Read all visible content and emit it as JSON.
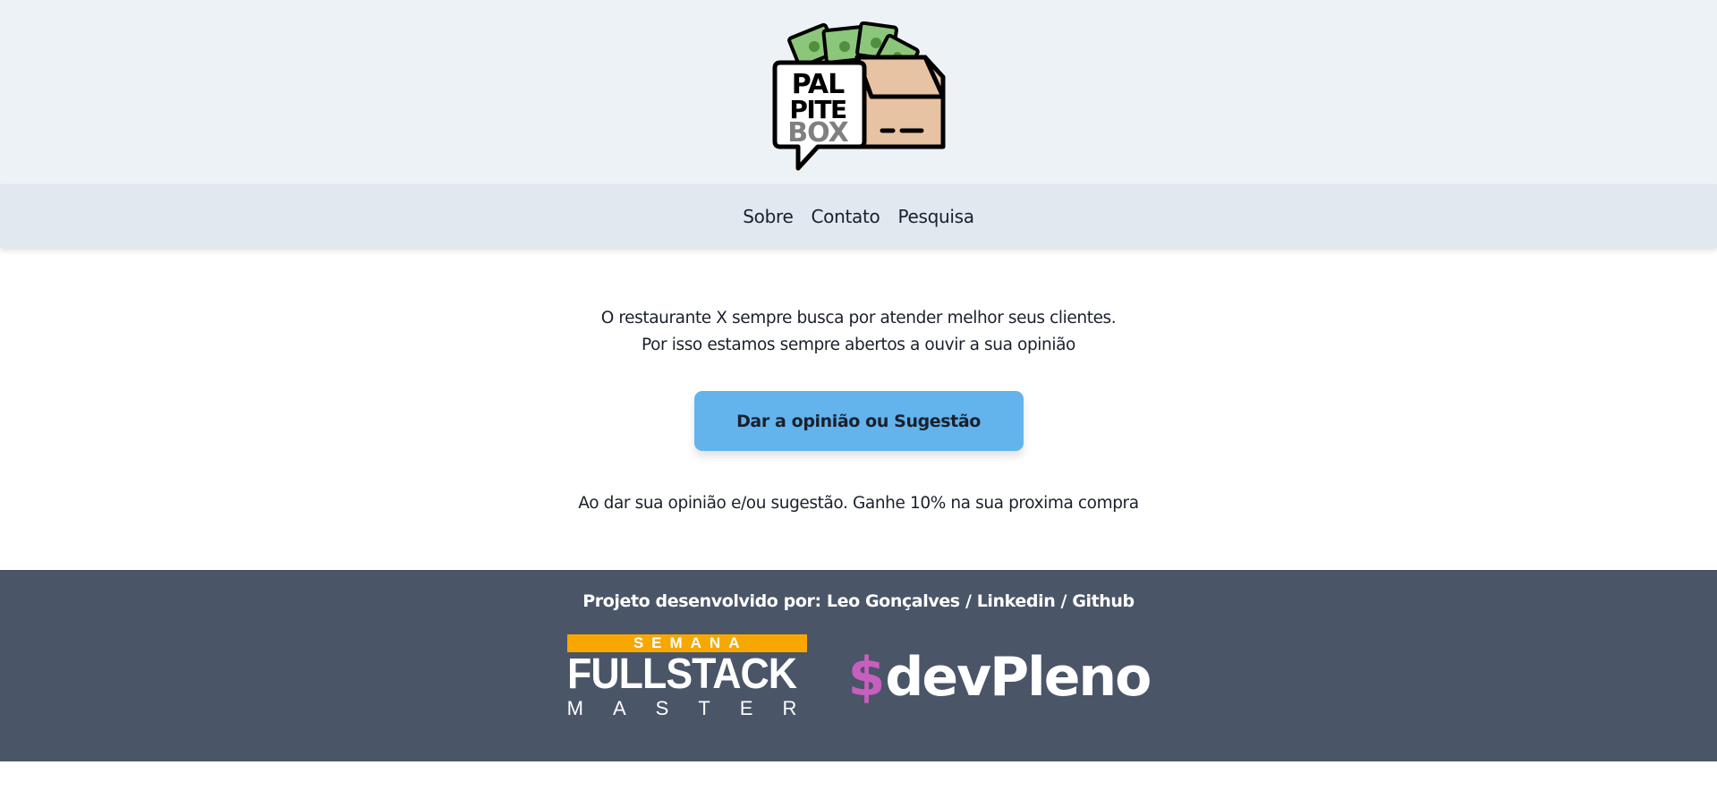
{
  "header": {
    "logo": {
      "name": "palpitebox-logo",
      "text_lines": [
        "PAL",
        "PITE",
        "BOX"
      ]
    }
  },
  "nav": {
    "items": [
      {
        "label": "Sobre"
      },
      {
        "label": "Contato"
      },
      {
        "label": "Pesquisa"
      }
    ]
  },
  "main": {
    "intro_line1": "O restaurante X sempre busca por atender melhor seus clientes.",
    "intro_line2": "Por isso estamos sempre abertos a ouvir a sua opinião",
    "cta_label": "Dar a opinião ou Sugestão",
    "promo": "Ao dar sua opinião e/ou sugestão. Ganhe 10% na sua proxima compra"
  },
  "footer": {
    "credit_prefix": "Projeto desenvolvido por: ",
    "author": "Leo Gonçalves",
    "sep1": " / ",
    "linkedin": "Linkedin",
    "sep2": " / ",
    "github": "Github",
    "sponsor1": {
      "top": "SEMANA",
      "middle": "FULLSTACK",
      "bottom": "MASTER"
    },
    "sponsor2": {
      "symbol": "$",
      "name": "devPleno"
    }
  },
  "colors": {
    "header_bg": "#edf2f7",
    "nav_bg": "#e2e8f0",
    "cta_bg": "#63b3ed",
    "footer_bg": "#4a5568",
    "fsm_orange": "#f7a700",
    "devpleno_pink": "#c85fbf"
  }
}
